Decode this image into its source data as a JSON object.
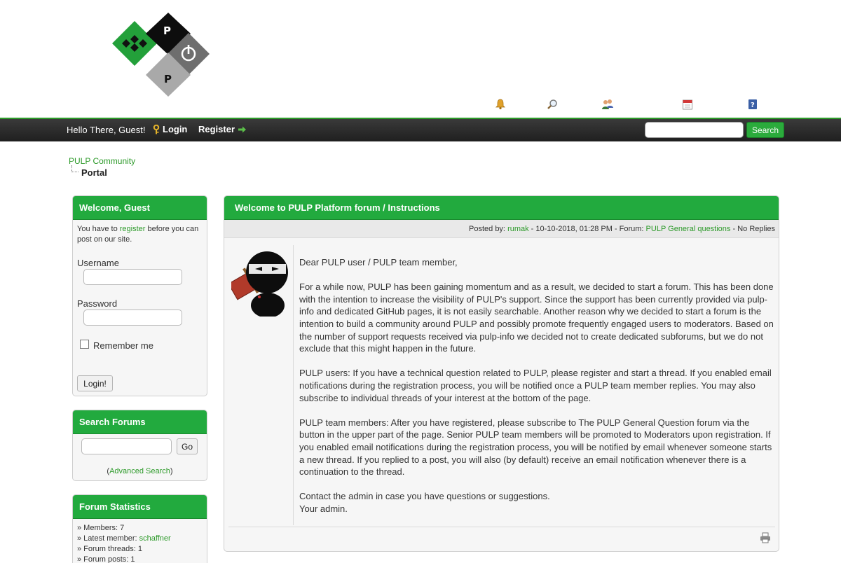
{
  "header": {
    "logo_letters": [
      "P",
      "P"
    ],
    "menu_icons": [
      {
        "name": "bell-icon",
        "color": "#d98f1c"
      },
      {
        "name": "magnifier-icon",
        "color": "#8a8a8a"
      },
      {
        "name": "members-icon",
        "color": "#3b7a3b"
      },
      {
        "name": "calendar-icon",
        "color": "#c83232"
      },
      {
        "name": "help-icon",
        "color": "#3a5fa5"
      }
    ]
  },
  "topbar": {
    "greeting": "Hello There, Guest!",
    "login_label": "Login",
    "register_label": "Register",
    "search_button": "Search",
    "search_placeholder": ""
  },
  "breadcrumb": {
    "root": "PULP Community",
    "current": "Portal"
  },
  "welcome_box": {
    "title": "Welcome, Guest",
    "intro_pre": "You have to ",
    "intro_link": "register",
    "intro_post": " before you can post on our site.",
    "username_label": "Username",
    "password_label": "Password",
    "remember_label": "Remember me",
    "login_button": "Login!"
  },
  "search_box": {
    "title": "Search Forums",
    "go_button": "Go",
    "advanced_pre": "(",
    "advanced_link": "Advanced Search",
    "advanced_post": ")"
  },
  "stats_box": {
    "title": "Forum Statistics",
    "members_label": "» Members: 7",
    "latest_label": "» Latest member: ",
    "latest_member": "schaffner",
    "threads_label": "» Forum threads: 1",
    "posts_label": "» Forum posts: 1"
  },
  "post": {
    "title": "Welcome to PULP Platform forum / Instructions",
    "meta_posted_by": "Posted by: ",
    "meta_author": "rumak",
    "meta_date": " - 10-10-2018, 01:28 PM - Forum: ",
    "meta_forum": "PULP General questions",
    "meta_replies": " - No Replies",
    "paragraphs": [
      "Dear PULP user / PULP team member,",
      "For a while now, PULP has been gaining momentum and as a result, we decided to start a forum. This has been done with the intention to increase the visibility of PULP's support. Since the support has been currently provided via pulp-info and dedicated GitHub pages, it is not easily searchable. Another reason why we decided to start a forum is the intention to build a community around PULP and possibly promote frequently engaged users to moderators. Based on the number of support requests received via pulp-info we decided not to create dedicated subforums, but we do not exclude that this might happen in the future.",
      "PULP users: If you have a technical question related to PULP, please register and start a thread. If you enabled email notifications during the registration process, you will be notified once a PULP team member replies. You may also subscribe to individual threads of your interest at the bottom of the page.",
      "PULP team members: After you have registered, please subscribe to The PULP General Question forum via the button in the upper part of the page. Senior PULP team members will be promoted to Moderators upon registration. If you enabled email notifications during the registration process, you will be notified by email whenever someone starts a new thread. If you replied to a post, you will also (by default) receive an email notification whenever there is a continuation to the thread.",
      "Contact the admin in case you have questions or suggestions.",
      "Your admin."
    ]
  },
  "colors": {
    "accent_green": "#22aa3e",
    "link_green": "#2d9a2a",
    "topbar_dark": "#1f1f1f"
  }
}
